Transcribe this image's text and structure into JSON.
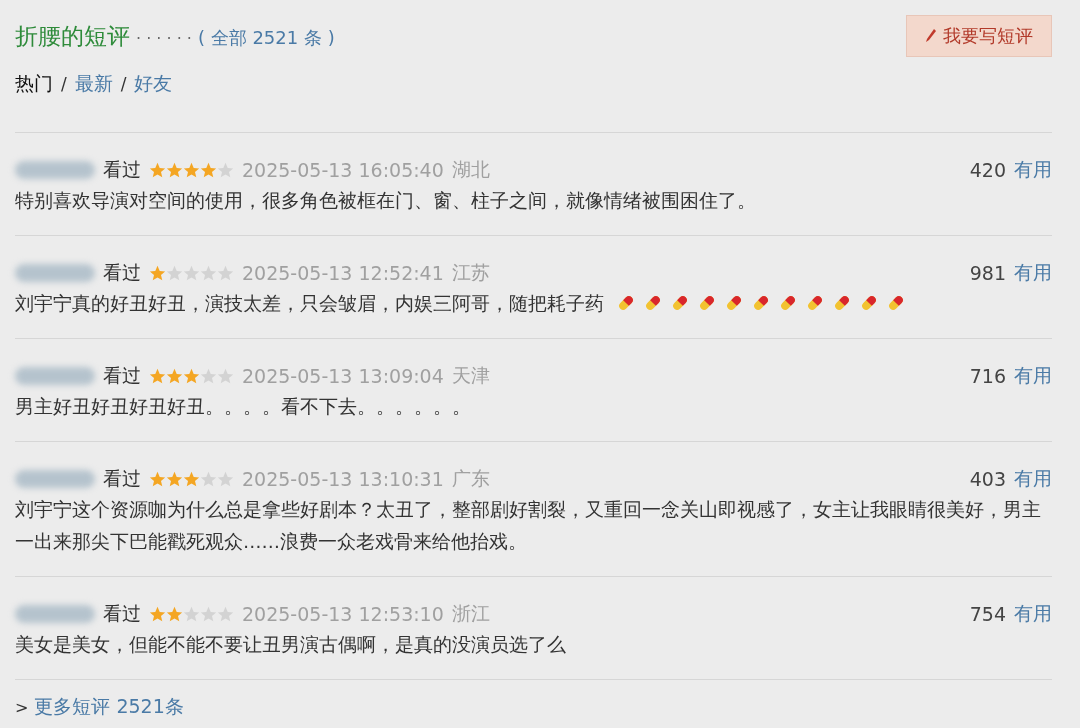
{
  "header": {
    "title": "折腰的短评",
    "dots": "· · · · · ·",
    "total": "( 全部 2521 条 )",
    "write_button": "我要写短评"
  },
  "tabs": [
    {
      "label": "热门",
      "selected": true,
      "separator": "/"
    },
    {
      "label": "最新",
      "selected": false,
      "separator": "/"
    },
    {
      "label": "好友",
      "selected": false
    }
  ],
  "reviews": [
    {
      "status": "看过",
      "stars": 4,
      "time": "2025-05-13 16:05:40",
      "location": "湖北",
      "votes": "420",
      "useful": "有用",
      "text": "特别喜欢导演对空间的使用，很多角色被框在门、窗、柱子之间，就像情绪被围困住了。"
    },
    {
      "status": "看过",
      "stars": 1,
      "time": "2025-05-13 12:52:41",
      "location": "江苏",
      "votes": "981",
      "useful": "有用",
      "text": "刘宇宁真的好丑好丑，演技太差，只会皱眉，内娱三阿哥，随把耗子药",
      "emoji": [
        {
          "kind": "pill"
        },
        {
          "kind": "pill"
        },
        {
          "kind": "pill"
        },
        {
          "kind": "pill"
        },
        {
          "kind": "pill"
        },
        {
          "kind": "pill"
        },
        {
          "kind": "pill"
        },
        {
          "kind": "pill"
        },
        {
          "kind": "pill"
        },
        {
          "kind": "pill"
        },
        {
          "kind": "pill"
        }
      ]
    },
    {
      "status": "看过",
      "stars": 3,
      "time": "2025-05-13 13:09:04",
      "location": "天津",
      "votes": "716",
      "useful": "有用",
      "text": "男主好丑好丑好丑好丑。。。。看不下去。。。。。。"
    },
    {
      "status": "看过",
      "stars": 3,
      "time": "2025-05-13 13:10:31",
      "location": "广东",
      "votes": "403",
      "useful": "有用",
      "text": "刘宇宁这个资源咖为什么总是拿些好剧本？太丑了，整部剧好割裂，又重回一念关山即视感了，女主让我眼睛很美好，男主一出来那尖下巴能戳死观众……浪费一众老戏骨来给他抬戏。"
    },
    {
      "status": "看过",
      "stars": 2,
      "time": "2025-05-13 12:53:10",
      "location": "浙江",
      "votes": "754",
      "useful": "有用",
      "text": "美女是美女，但能不能不要让丑男演古偶啊，是真的没演员选了么"
    }
  ],
  "more": {
    "arrow": ">",
    "label": "更多短评 2521条"
  }
}
